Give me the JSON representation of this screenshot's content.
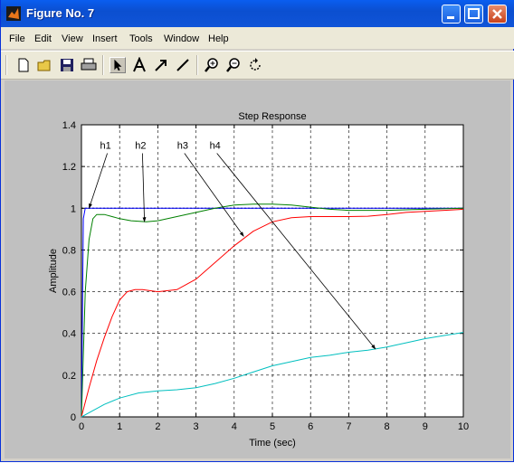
{
  "window": {
    "title": "Figure No. 7",
    "menu": [
      "File",
      "Edit",
      "View",
      "Insert",
      "Tools",
      "Window",
      "Help"
    ],
    "toolbar_icons": [
      "new-file-icon",
      "open-folder-icon",
      "save-icon",
      "print-icon",
      "select-arrow-icon",
      "insert-text-icon",
      "insert-arrow-icon",
      "insert-line-icon",
      "zoom-in-icon",
      "zoom-out-icon",
      "rotate-3d-icon"
    ]
  },
  "colors": {
    "h1": "#0000ff",
    "h2": "#008000",
    "h3": "#ff0000",
    "h4": "#00bfbf"
  },
  "chart_data": {
    "type": "line",
    "title": "Step Response",
    "xlabel": "Time (sec)",
    "ylabel": "Amplitude",
    "xlim": [
      0,
      10
    ],
    "ylim": [
      0,
      1.4
    ],
    "x_ticks": [
      "0",
      "1",
      "2",
      "3",
      "4",
      "5",
      "6",
      "7",
      "8",
      "9",
      "10"
    ],
    "y_ticks": [
      "0",
      "0.2",
      "0.4",
      "0.6",
      "0.8",
      "1",
      "1.2",
      "1.4"
    ],
    "grid": true,
    "series": [
      {
        "name": "h1",
        "color": "#0000ff",
        "x": [
          0,
          0.05,
          0.1,
          0.15,
          0.2,
          0.5,
          1,
          2,
          3,
          4,
          5,
          6,
          7,
          8,
          9,
          10
        ],
        "y": [
          0,
          0.95,
          1.0,
          1.0,
          1.0,
          1.0,
          1.0,
          1.0,
          1.0,
          1.0,
          1.0,
          1.0,
          1.0,
          1.0,
          1.0,
          1.0
        ]
      },
      {
        "name": "h2",
        "color": "#008000",
        "x": [
          0,
          0.05,
          0.1,
          0.2,
          0.3,
          0.4,
          0.6,
          0.8,
          1,
          1.3,
          1.7,
          2,
          2.5,
          3,
          3.5,
          4,
          4.5,
          5,
          5.5,
          6,
          6.5,
          7,
          8,
          9,
          10
        ],
        "y": [
          0,
          0.3,
          0.6,
          0.85,
          0.95,
          0.97,
          0.97,
          0.96,
          0.95,
          0.94,
          0.935,
          0.94,
          0.96,
          0.98,
          1.0,
          1.015,
          1.02,
          1.02,
          1.015,
          1.005,
          0.995,
          0.99,
          0.99,
          0.995,
          1.0
        ]
      },
      {
        "name": "h3",
        "color": "#ff0000",
        "x": [
          0,
          0.2,
          0.4,
          0.6,
          0.8,
          1,
          1.2,
          1.4,
          1.6,
          2,
          2.5,
          3,
          3.5,
          4,
          4.5,
          5,
          5.5,
          6,
          6.5,
          7,
          7.5,
          8,
          8.5,
          9,
          9.5,
          10
        ],
        "y": [
          0,
          0.14,
          0.27,
          0.38,
          0.48,
          0.56,
          0.6,
          0.61,
          0.61,
          0.6,
          0.61,
          0.66,
          0.74,
          0.82,
          0.89,
          0.935,
          0.955,
          0.96,
          0.96,
          0.96,
          0.962,
          0.97,
          0.98,
          0.985,
          0.99,
          0.995
        ]
      },
      {
        "name": "h4",
        "color": "#00bfbf",
        "x": [
          0,
          0.3,
          0.6,
          1,
          1.5,
          2,
          2.5,
          3,
          3.5,
          4,
          4.5,
          5,
          5.5,
          6,
          6.5,
          7,
          7.5,
          8,
          8.5,
          9,
          9.5,
          10
        ],
        "y": [
          0,
          0.03,
          0.06,
          0.09,
          0.115,
          0.125,
          0.13,
          0.14,
          0.16,
          0.185,
          0.215,
          0.245,
          0.265,
          0.285,
          0.295,
          0.31,
          0.32,
          0.335,
          0.355,
          0.375,
          0.39,
          0.405
        ]
      }
    ],
    "annotations": [
      {
        "text": "h1",
        "label_at": [
          0.63,
          1.285
        ],
        "arrow_to": [
          0.2,
          1.0
        ]
      },
      {
        "text": "h2",
        "label_at": [
          1.55,
          1.285
        ],
        "arrow_to": [
          1.65,
          0.935
        ]
      },
      {
        "text": "h3",
        "label_at": [
          2.65,
          1.285
        ],
        "arrow_to": [
          4.25,
          0.865
        ]
      },
      {
        "text": "h4",
        "label_at": [
          3.5,
          1.285
        ],
        "arrow_to": [
          7.7,
          0.325
        ]
      }
    ]
  }
}
